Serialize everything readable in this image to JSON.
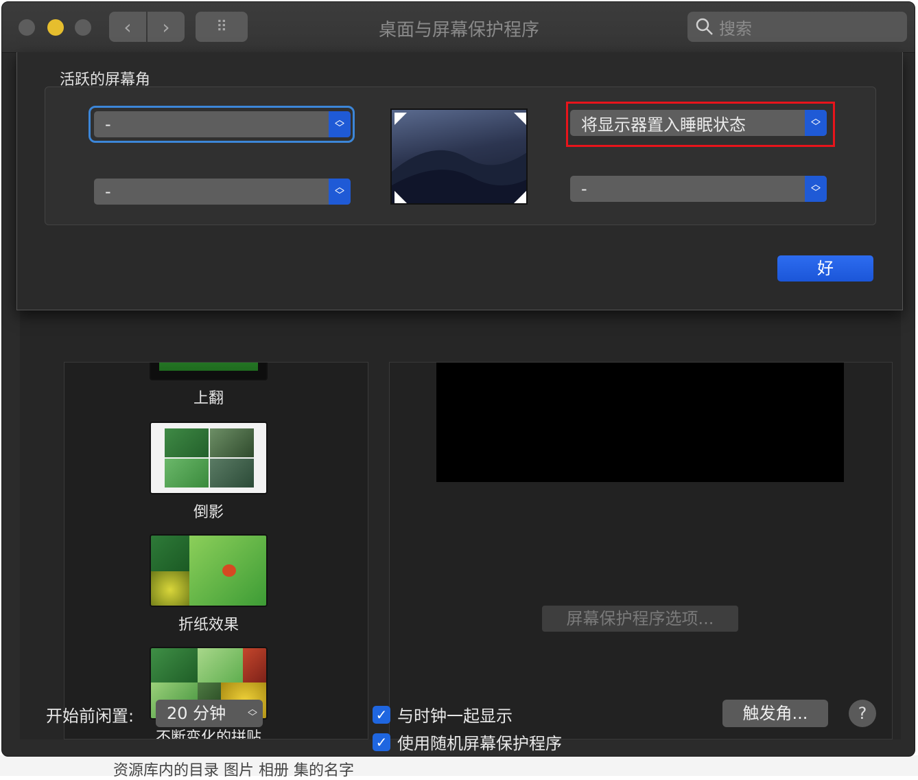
{
  "window": {
    "title": "桌面与屏幕保护程序"
  },
  "toolbar": {
    "back_glyph": "‹",
    "forward_glyph": "›",
    "grid_glyph": "⠿",
    "search_placeholder": "搜索"
  },
  "screensavers": [
    {
      "label": "上翻"
    },
    {
      "label": "倒影"
    },
    {
      "label": "折纸效果"
    },
    {
      "label": "不断变化的拼贴"
    }
  ],
  "screensaver_options_label": "屏幕保护程序选项...",
  "bottom": {
    "idle_label": "开始前闲置:",
    "idle_value": "20 分钟",
    "show_clock_label": "与时钟一起显示",
    "random_label": "使用随机屏幕保护程序",
    "hot_corners_button": "触发角...",
    "help_glyph": "?"
  },
  "sheet": {
    "title": "活跃的屏幕角",
    "top_left_value": "-",
    "bottom_left_value": "-",
    "top_right_value": "将显示器置入睡眠状态",
    "bottom_right_value": "-",
    "ok_label": "好"
  },
  "background_text": "资源库内的目录 图片 相册 集的名字",
  "colors": {
    "accent": "#1f5ad6",
    "highlight": "#e8141b"
  }
}
